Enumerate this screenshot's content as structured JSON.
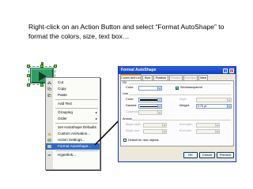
{
  "instruction": {
    "line1": "Right-click on an Action Button and select “Format AutoShape” to",
    "line2": "format the colors, size, text box…"
  },
  "context_menu": {
    "items": [
      {
        "label": "Cut",
        "icon": "scissors-icon"
      },
      {
        "label": "Copy",
        "icon": "copy-icon"
      },
      {
        "label": "Paste",
        "icon": "paste-icon"
      },
      {
        "label": "Add Text",
        "icon": ""
      },
      {
        "label": "Grouping",
        "icon": ""
      },
      {
        "label": "Order",
        "icon": ""
      },
      {
        "label": "Set AutoShape Defaults",
        "icon": ""
      },
      {
        "label": "Custom Animation...",
        "icon": "animation-icon"
      },
      {
        "label": "Action Settings...",
        "icon": "action-icon"
      },
      {
        "label": "Format AutoShape...",
        "icon": "format-icon"
      },
      {
        "label": "Hyperlink...",
        "icon": "hyperlink-icon"
      }
    ],
    "highlighted": "Format AutoShape..."
  },
  "dialog": {
    "title": "Format AutoShape",
    "help_glyph": "?",
    "close_glyph": "×",
    "tabs": [
      "Colors and Lines",
      "Size",
      "Position",
      "Picture",
      "Text Box",
      "Web"
    ],
    "active_tab": "Colors and Lines",
    "fill": {
      "group": "Fill",
      "color_label": "Color:",
      "semi_transparent_label": "Semitransparent",
      "semi_transparent_checked": true
    },
    "line": {
      "group": "Line",
      "color_label": "Color:",
      "style_label": "Style:",
      "dashed_label": "Dashed:",
      "weight_label": "Weight:",
      "weight_value": "0.75 pt",
      "connector_label": "Connector:"
    },
    "arrows": {
      "group": "Arrows",
      "begin_style_label": "Begin style:",
      "end_style_label": "End style:",
      "begin_size_label": "Begin size:",
      "end_size_label": "End size:"
    },
    "default_label": "Default for new objects",
    "default_checked": false,
    "buttons": {
      "ok": "OK",
      "cancel": "Cancel",
      "preview": "Preview"
    }
  },
  "colors": {
    "action_button_fill": "#2e9f67",
    "menu_highlight": "#316ac5",
    "title_bar": "#0a3fc4",
    "pointer_arrow": "#000000"
  }
}
